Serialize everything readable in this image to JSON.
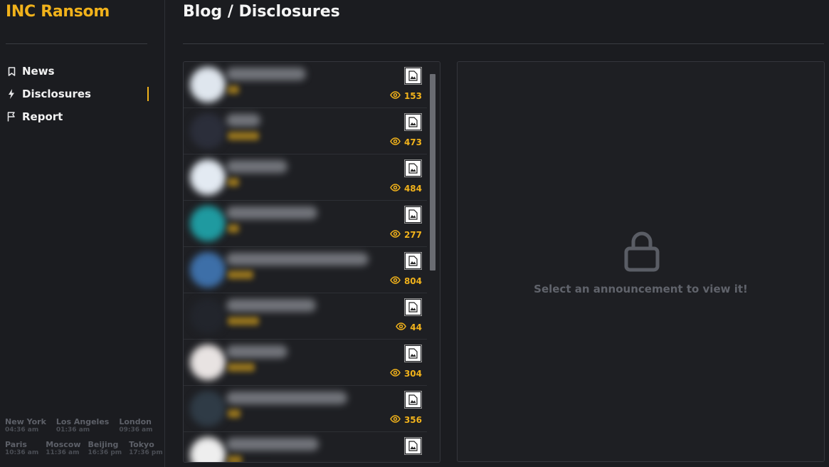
{
  "brand": "INC Ransom",
  "page_title": "Blog / Disclosures",
  "nav": [
    {
      "label": "News",
      "icon": "bookmark-icon"
    },
    {
      "label": "Disclosures",
      "icon": "bolt-icon",
      "active": true
    },
    {
      "label": "Report",
      "icon": "flag-icon"
    }
  ],
  "clocks": [
    [
      {
        "city": "New York",
        "time": "04:36 am"
      },
      {
        "city": "Los Angeles",
        "time": "01:36 am"
      },
      {
        "city": "London",
        "time": "09:36 am"
      }
    ],
    [
      {
        "city": "Paris",
        "time": "10:36 am"
      },
      {
        "city": "Moscow",
        "time": "11:36 am"
      },
      {
        "city": "Beijing",
        "time": "16:36 pm"
      },
      {
        "city": "Tokyo",
        "time": "17:36 pm"
      }
    ]
  ],
  "posts": [
    {
      "views": "153",
      "avatar_color": "#dfe6ee"
    },
    {
      "views": "473",
      "avatar_color": "#2b2e3a"
    },
    {
      "views": "484",
      "avatar_color": "#e3eaf2"
    },
    {
      "views": "277",
      "avatar_color": "#1f9aa0"
    },
    {
      "views": "804",
      "avatar_color": "#3d6fa8"
    },
    {
      "views": "44",
      "avatar_color": "#22252c"
    },
    {
      "views": "304",
      "avatar_color": "#e8e3e2"
    },
    {
      "views": "356",
      "avatar_color": "#2f3b46"
    },
    {
      "views": "",
      "avatar_color": "#eeeeee"
    }
  ],
  "viewer": {
    "message": "Select an announcement to view it!",
    "icon": "lock-icon"
  },
  "colors": {
    "accent": "#f1b21b",
    "background": "#1b1c20",
    "panel": "#1e1f23"
  }
}
